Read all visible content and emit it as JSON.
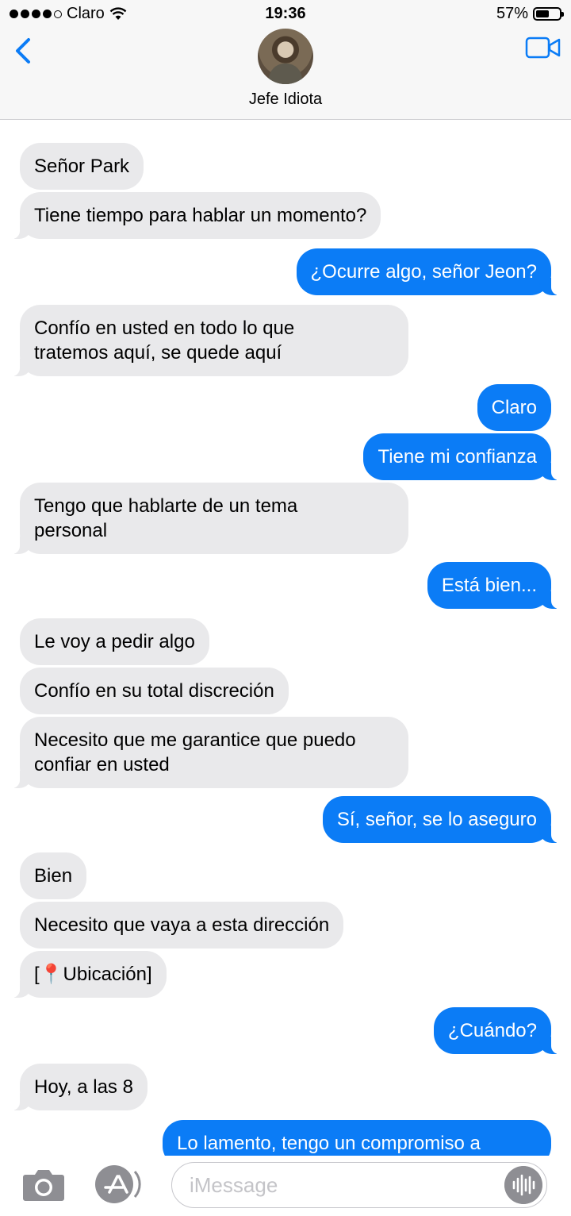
{
  "status": {
    "carrier": "Claro",
    "time": "19:36",
    "battery": "57%",
    "battery_level": 0.57
  },
  "header": {
    "contact_name": "Jefe Idiota"
  },
  "messages": [
    {
      "from": "in",
      "text": "Señor Park"
    },
    {
      "from": "in",
      "text": "Tiene tiempo para hablar un momento?"
    },
    {
      "from": "out",
      "text": "¿Ocurre algo, señor Jeon?"
    },
    {
      "from": "in",
      "text": "Confío en usted en todo lo que\ntratemos aquí, se quede aquí"
    },
    {
      "from": "out",
      "text": "Claro"
    },
    {
      "from": "out",
      "text": "Tiene mi confianza"
    },
    {
      "from": "in",
      "text": "Tengo que hablarte de un tema\npersonal"
    },
    {
      "from": "out",
      "text": "Está bien..."
    },
    {
      "from": "in",
      "text": "Le voy a pedir algo"
    },
    {
      "from": "in",
      "text": "Confío en su total discreción"
    },
    {
      "from": "in",
      "text": "Necesito que me garantice que puedo\nconfiar en usted"
    },
    {
      "from": "out",
      "text": "Sí, señor, se lo aseguro"
    },
    {
      "from": "in",
      "text": "Bien"
    },
    {
      "from": "in",
      "text": "Necesito que vaya a esta dirección"
    },
    {
      "from": "in",
      "text": "[📍Ubicación]"
    },
    {
      "from": "out",
      "text": "¿Cuándo?"
    },
    {
      "from": "in",
      "text": "Hoy, a las 8"
    },
    {
      "from": "out",
      "text": "Lo lamento, tengo un compromiso a"
    }
  ],
  "composer": {
    "placeholder": "iMessage"
  },
  "icons": [
    "signal-dots-icon",
    "wifi-icon",
    "battery-icon",
    "back-chevron-icon",
    "video-call-icon",
    "camera-icon",
    "app-store-icon",
    "audio-waveform-icon"
  ]
}
